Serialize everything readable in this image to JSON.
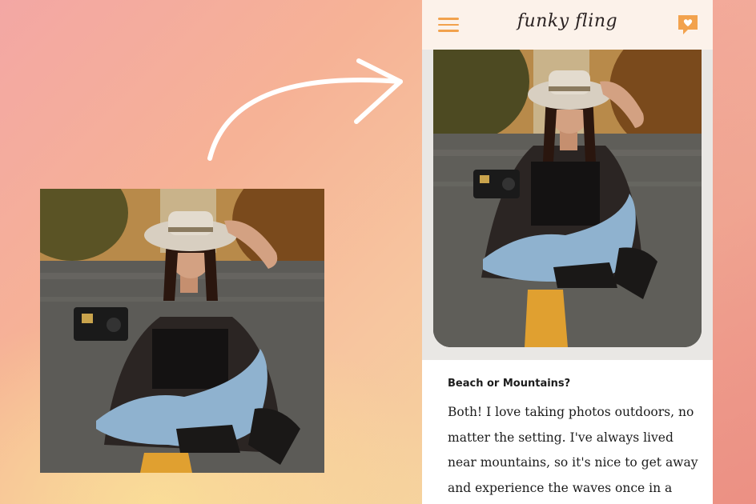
{
  "app": {
    "title": "funky fling",
    "menu_icon": "hamburger-menu-icon",
    "chat_icon": "heart-chat-icon"
  },
  "prompt_card": {
    "question": "Beach or Mountains?",
    "answer": "Both! I love taking photos outdoors, no matter the setting. I've always lived near mountains, so it's nice to get away and experience the waves once in a while."
  },
  "colors": {
    "accent": "#f2a24d",
    "header_bg": "#fcf2ea",
    "text": "#1c1c1c"
  }
}
